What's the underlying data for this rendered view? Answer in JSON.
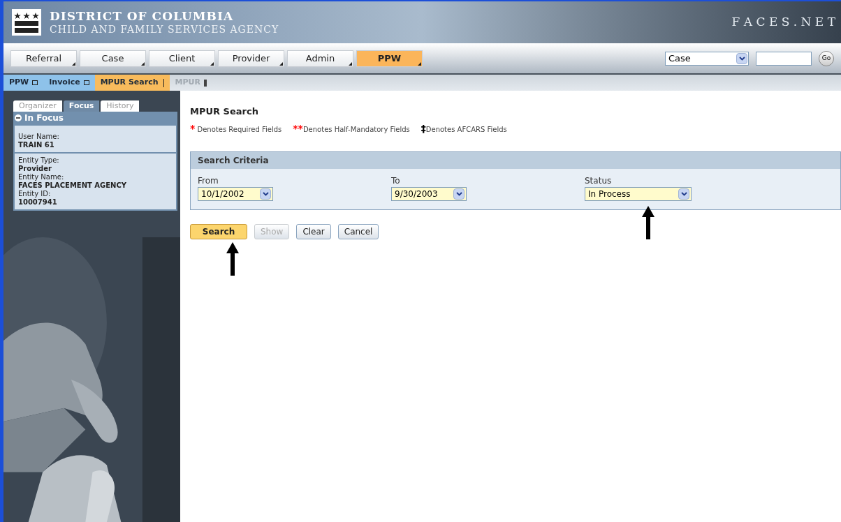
{
  "header": {
    "title": "DISTRICT OF COLUMBIA",
    "subtitle": "CHILD AND FAMILY SERVICES AGENCY",
    "product": "F A C E S . N E T"
  },
  "nav": {
    "tabs": [
      {
        "label": "Referral",
        "selected": false
      },
      {
        "label": "Case",
        "selected": false
      },
      {
        "label": "Client",
        "selected": false
      },
      {
        "label": "Provider",
        "selected": false
      },
      {
        "label": "Admin",
        "selected": false
      },
      {
        "label": "PPW",
        "selected": true
      }
    ],
    "search_select": {
      "value": "Case"
    },
    "go_button": "Go"
  },
  "breadcrumbs": [
    {
      "label": "PPW",
      "kind": "done"
    },
    {
      "label": "Invoice",
      "kind": "done"
    },
    {
      "label": "MPUR Search",
      "kind": "current"
    },
    {
      "label": "MPUR",
      "kind": "disabled"
    }
  ],
  "sidebar": {
    "tabs": [
      {
        "label": "Organizer",
        "selected": false
      },
      {
        "label": "Focus",
        "selected": true
      },
      {
        "label": "History",
        "selected": false
      }
    ],
    "panel_title": "In Focus",
    "sections": [
      [
        {
          "label": "User Name:",
          "value": "TRAIN 61"
        }
      ],
      [
        {
          "label": "Entity Type:",
          "value": "Provider"
        },
        {
          "label": "Entity Name:",
          "value": "FACES PLACEMENT AGENCY"
        },
        {
          "label": "Entity ID:",
          "value": "10007941"
        }
      ]
    ]
  },
  "main": {
    "title": "MPUR Search",
    "legend": [
      {
        "marker": "*",
        "text": " Denotes Required Fields",
        "color": "#ff0000"
      },
      {
        "marker": "**",
        "text": "Denotes Half-Mandatory Fields",
        "color": "#ff0000"
      },
      {
        "marker": "‡",
        "text": "Denotes AFCARS Fields",
        "color": "#000000"
      }
    ],
    "criteria": {
      "title": "Search Criteria",
      "fields": [
        {
          "label": "From",
          "value": "10/1/2002"
        },
        {
          "label": "To",
          "value": "9/30/2003"
        },
        {
          "label": "Status",
          "value": "In Process"
        }
      ]
    },
    "buttons": [
      {
        "label": "Search",
        "kind": "primary",
        "disabled": false
      },
      {
        "label": "Show",
        "kind": "normal",
        "disabled": true
      },
      {
        "label": "Clear",
        "kind": "normal",
        "disabled": false
      },
      {
        "label": "Cancel",
        "kind": "normal",
        "disabled": false
      }
    ]
  }
}
